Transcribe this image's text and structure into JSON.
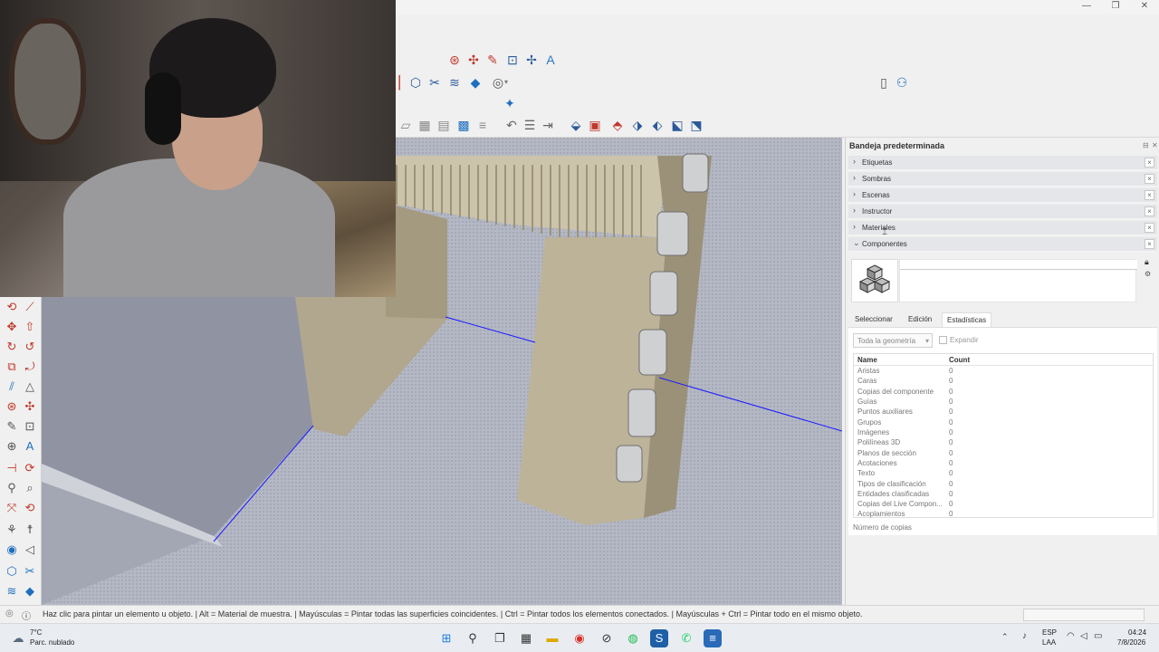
{
  "window": {
    "minimize_symbol": "—",
    "maximize_symbol": "❐",
    "close_symbol": "✕"
  },
  "tray": {
    "title": "Bandeja predeterminada",
    "panels": [
      {
        "label": "Etiquetas",
        "expanded": false
      },
      {
        "label": "Sombras",
        "expanded": false
      },
      {
        "label": "Escenas",
        "expanded": false
      },
      {
        "label": "Instructor",
        "expanded": false
      },
      {
        "label": "Materiales",
        "expanded": false
      },
      {
        "label": "Componentes",
        "expanded": true
      }
    ],
    "components": {
      "name_value": "",
      "tabs": [
        "Seleccionar",
        "Edición",
        "Estadísticas"
      ],
      "active_tab": "Estadísticas",
      "geometry_select": "Toda la geometría",
      "expand_label": "Expandir",
      "columns": [
        "Name",
        "Count"
      ],
      "stats": [
        {
          "name": "Aristas",
          "count": "0"
        },
        {
          "name": "Caras",
          "count": "0"
        },
        {
          "name": "Copias del componente",
          "count": "0"
        },
        {
          "name": "Guías",
          "count": "0"
        },
        {
          "name": "Puntos auxiliares",
          "count": "0"
        },
        {
          "name": "Grupos",
          "count": "0"
        },
        {
          "name": "Imágenes",
          "count": "0"
        },
        {
          "name": "Polilíneas 3D",
          "count": "0"
        },
        {
          "name": "Planos de sección",
          "count": "0"
        },
        {
          "name": "Acotaciones",
          "count": "0"
        },
        {
          "name": "Texto",
          "count": "0"
        },
        {
          "name": "Tipos de clasificación",
          "count": "0"
        },
        {
          "name": "Entidades clasificadas",
          "count": "0"
        },
        {
          "name": "Copias del Live Compon...",
          "count": "0"
        },
        {
          "name": "Acoplamientos",
          "count": "0"
        }
      ],
      "copies_label": "Número de copias"
    }
  },
  "status": {
    "text": "Haz clic para pintar un elemento u objeto. | Alt = Material de muestra. | Mayúsculas = Pintar todas las superficies coincidentes. | Ctrl = Pintar todos los elementos conectados. | Mayúsculas + Ctrl = Pintar todo en el mismo objeto."
  },
  "taskbar": {
    "weather_temp": "7°C",
    "weather_desc": "Parc. nublado",
    "lang_top": "ESP",
    "lang_bottom": "LAA",
    "time": "04:24",
    "date": "7/8/2026"
  },
  "colors": {
    "accent": "#2a5a9a",
    "axis_blue": "#1a1aff",
    "wood": "#b8ad93"
  }
}
